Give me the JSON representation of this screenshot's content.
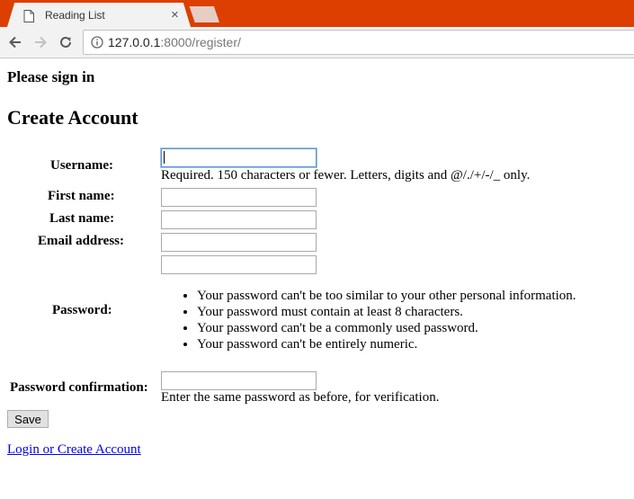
{
  "browser": {
    "tab_title": "Reading List",
    "tab_close": "×",
    "url_host": "127.0.0.1",
    "url_path": ":8000/register/",
    "theme_color": "#dc3f00"
  },
  "page": {
    "signin_heading": "Please sign in",
    "title": "Create Account",
    "form": {
      "username_label": "Username:",
      "username_value": "",
      "username_help": "Required. 150 characters or fewer. Letters, digits and @/./+/-/_ only.",
      "first_name_label": "First name:",
      "first_name_value": "",
      "last_name_label": "Last name:",
      "last_name_value": "",
      "email_label": "Email address:",
      "email_value": "",
      "password_label": "Password:",
      "password_value": "",
      "password_rules": [
        "Your password can't be too similar to your other personal information.",
        "Your password must contain at least 8 characters.",
        "Your password can't be a commonly used password.",
        "Your password can't be entirely numeric."
      ],
      "password_confirm_label": "Password confirmation:",
      "password_confirm_value": "",
      "password_confirm_help": "Enter the same password as before, for verification.",
      "save_label": "Save"
    },
    "login_link": "Login or Create Account"
  }
}
